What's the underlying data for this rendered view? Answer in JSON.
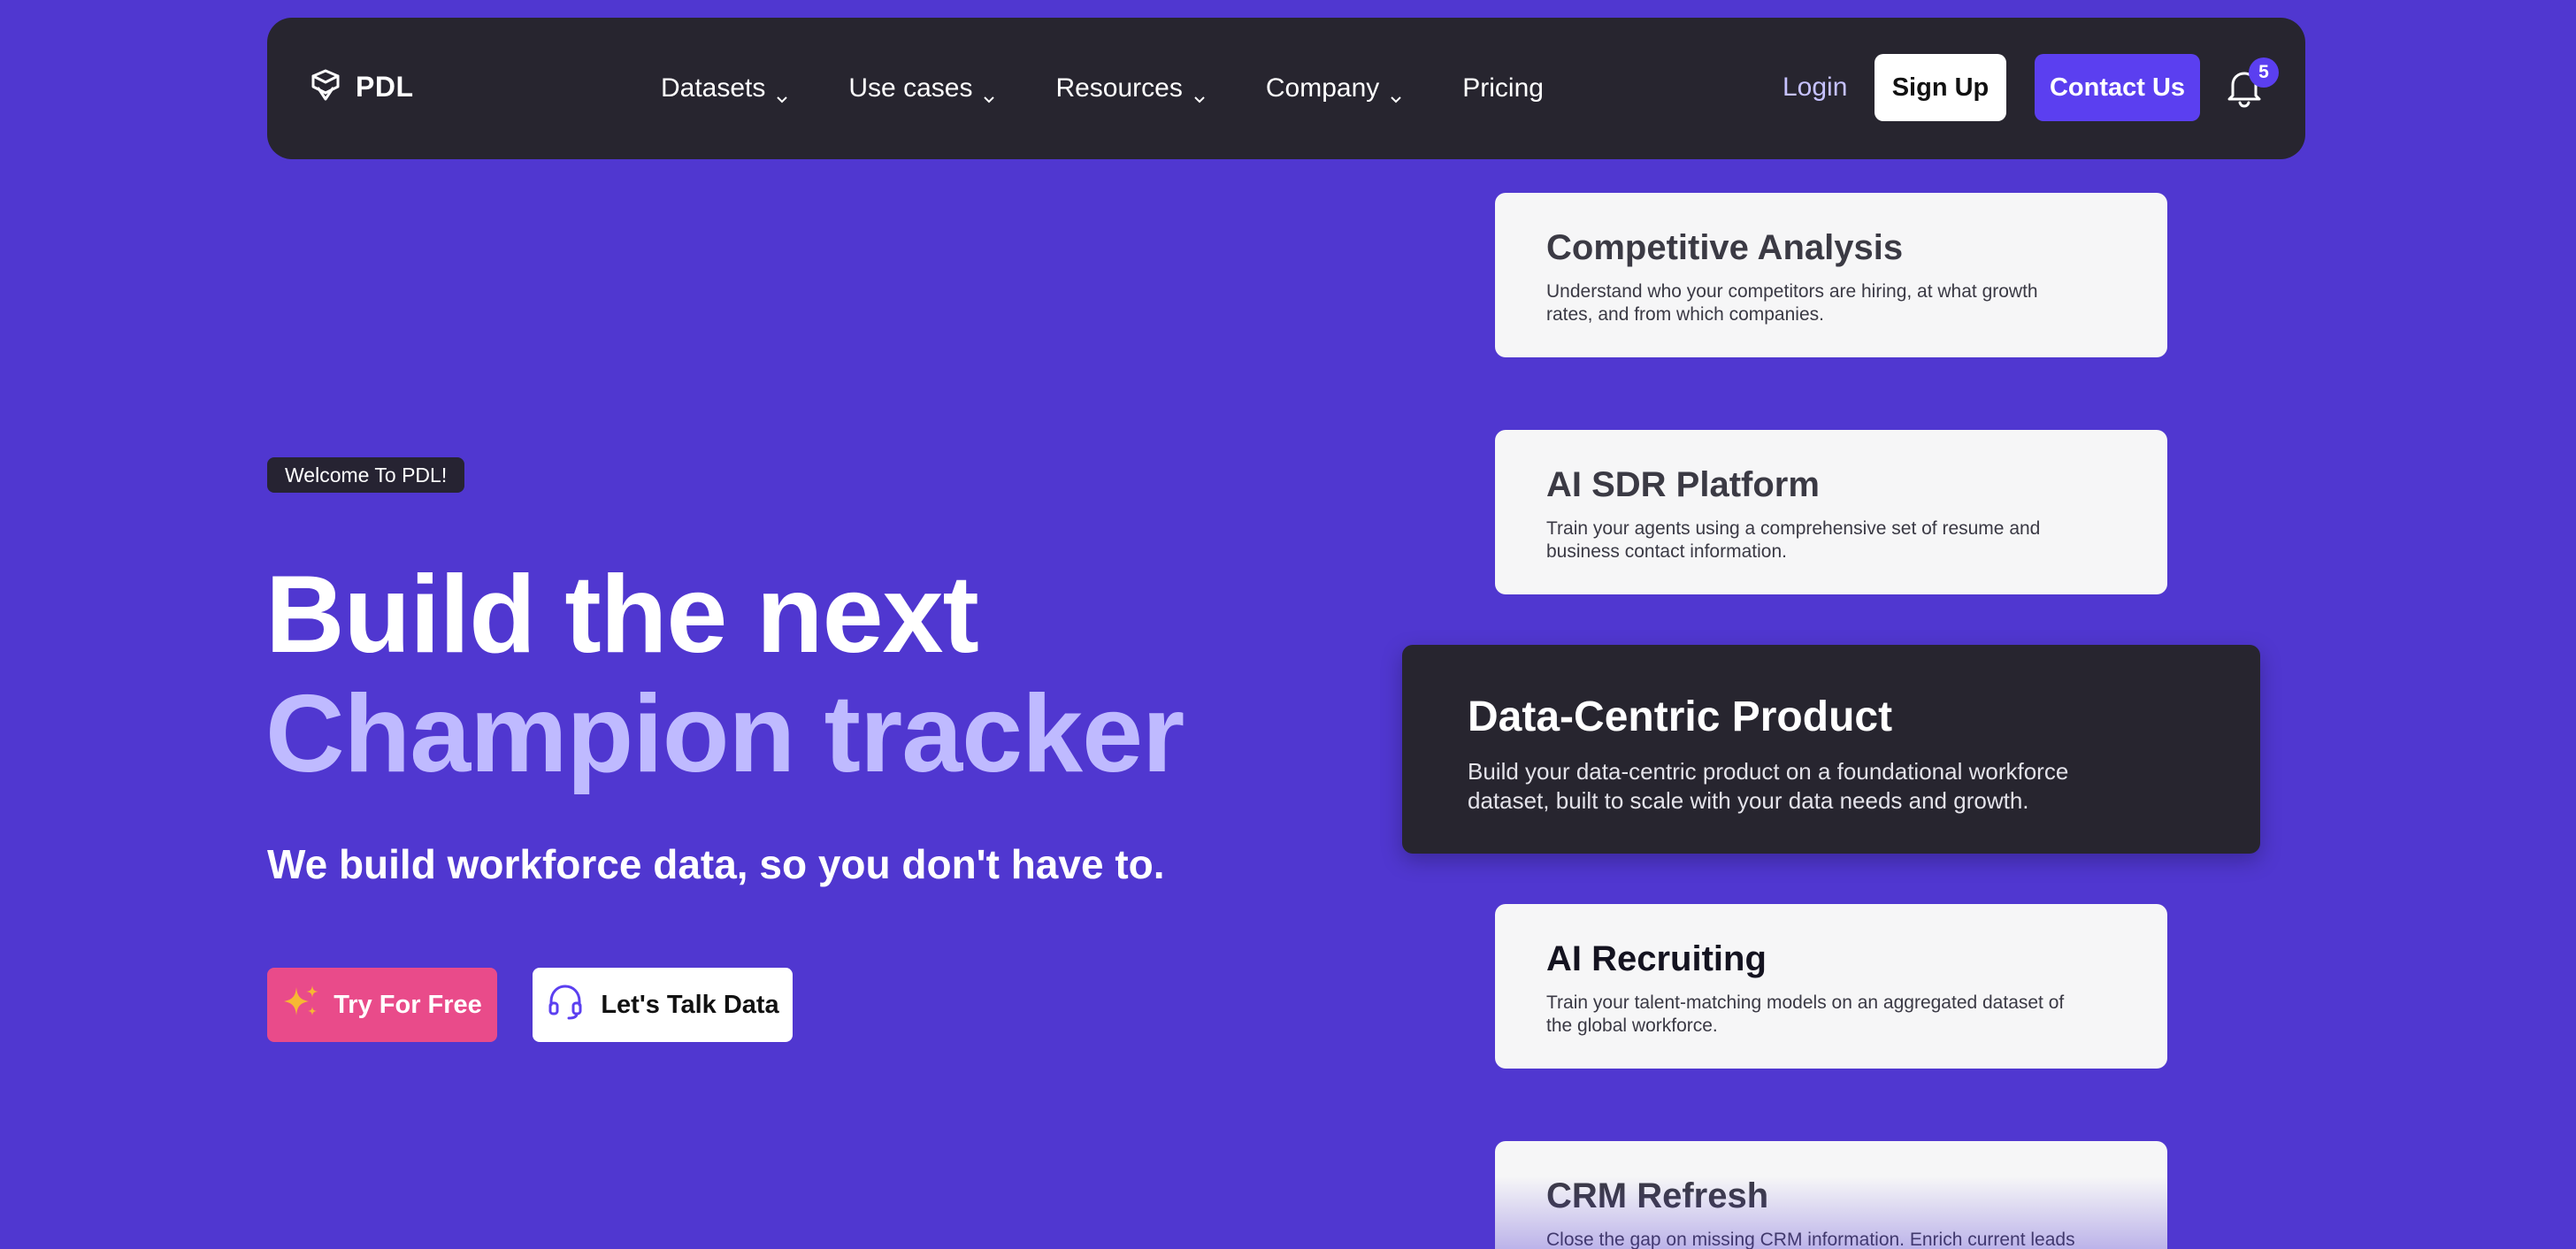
{
  "nav": {
    "logo_text": "PDL",
    "links": [
      {
        "label": "Datasets",
        "has_dropdown": true
      },
      {
        "label": "Use cases",
        "has_dropdown": true
      },
      {
        "label": "Resources",
        "has_dropdown": true
      },
      {
        "label": "Company",
        "has_dropdown": true
      },
      {
        "label": "Pricing",
        "has_dropdown": false
      }
    ],
    "login_label": "Login",
    "signup_label": "Sign Up",
    "contact_label": "Contact Us",
    "notification_count": "5"
  },
  "hero": {
    "badge": "Welcome To PDL!",
    "headline_line1": "Build the next",
    "headline_line2": "Champion tracker",
    "subheadline": "We build workforce data, so you don't have to.",
    "try_label": "Try For Free",
    "talk_label": "Let's Talk Data"
  },
  "use_cases": [
    {
      "title": "Competitive Analysis",
      "description": "Understand who your competitors are hiring, at what growth rates, and from which companies."
    },
    {
      "title": "AI SDR Platform",
      "description": "Train your agents using a comprehensive set of resume and business contact information."
    },
    {
      "title": "Data-Centric Product",
      "description": "Build your data-centric product on a foundational workforce dataset, built to scale with your data needs and growth."
    },
    {
      "title": "AI Recruiting",
      "description": "Train your talent-matching models on an aggregated dataset of the global workforce."
    },
    {
      "title": "CRM Refresh",
      "description": "Close the gap on missing CRM information. Enrich current leads"
    }
  ],
  "colors": {
    "background": "#5037d0",
    "nav_bg": "#27252f",
    "accent": "#5b3ff0",
    "headline_highlight": "#bfbaff",
    "try_button": "#e94b8a"
  }
}
